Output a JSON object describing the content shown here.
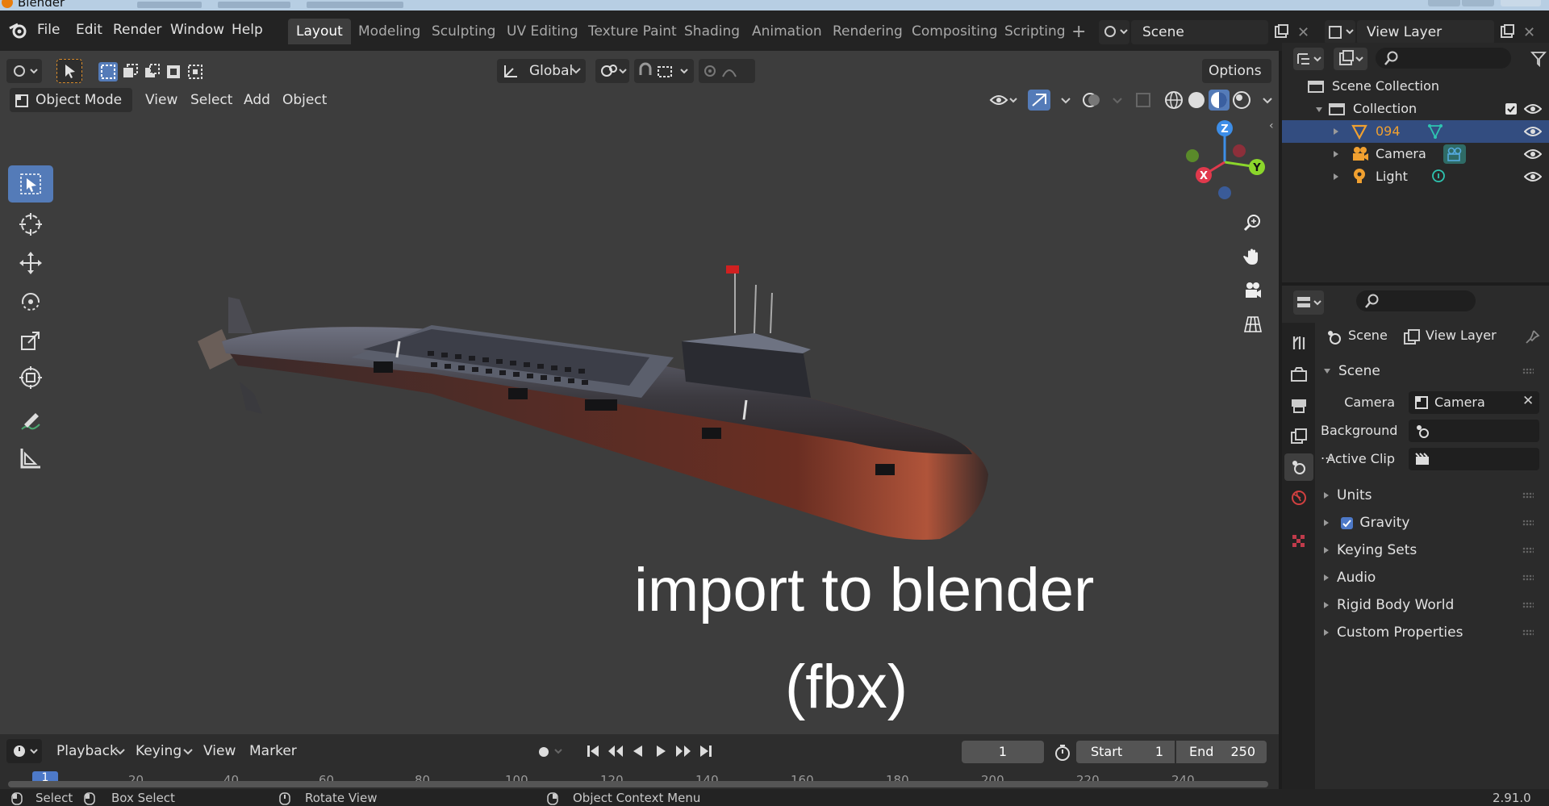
{
  "window": {
    "title": "Blender"
  },
  "menu": [
    "File",
    "Edit",
    "Render",
    "Window",
    "Help"
  ],
  "workspaces": {
    "active": "Layout",
    "tabs": [
      "Layout",
      "Modeling",
      "Sculpting",
      "UV Editing",
      "Texture Paint",
      "Shading",
      "Animation",
      "Rendering",
      "Compositing",
      "Scripting"
    ]
  },
  "scene_selector": "Scene",
  "view_layer_selector": "View Layer",
  "header_tools": {
    "transform_orientation": "Global",
    "options": "Options"
  },
  "viewport_header": {
    "mode": "Object Mode",
    "menus": [
      "View",
      "Select",
      "Add",
      "Object"
    ]
  },
  "toolbar": [
    "select-box",
    "cursor",
    "move",
    "rotate",
    "scale",
    "transform",
    "annotate",
    "measure"
  ],
  "overlay_text": {
    "line1": "import to blender",
    "line2": "(fbx)"
  },
  "gizmo": {
    "x": "X",
    "y": "Y",
    "z": "Z",
    "colors": {
      "x": "#e0394c",
      "y": "#8bd62b",
      "z": "#3d8ee8"
    }
  },
  "outliner": {
    "root": "Scene Collection",
    "collection": "Collection",
    "items": [
      {
        "name": "094",
        "type": "mesh",
        "selected": true
      },
      {
        "name": "Camera",
        "type": "camera",
        "selected": false
      },
      {
        "name": "Light",
        "type": "light",
        "selected": false
      }
    ]
  },
  "properties": {
    "breadcrumb": {
      "scene": "Scene",
      "view_layer": "View Layer"
    },
    "panel_title": "Scene",
    "fields": [
      {
        "label": "Camera",
        "value": "Camera"
      },
      {
        "label": "Background ...",
        "value": ""
      },
      {
        "label": "Active Clip",
        "value": ""
      }
    ],
    "sections": [
      "Units",
      "Gravity",
      "Keying Sets",
      "Audio",
      "Rigid Body World",
      "Custom Properties"
    ],
    "gravity_checked": true
  },
  "timeline": {
    "menus": [
      "Playback",
      "Keying",
      "View",
      "Marker"
    ],
    "current_frame": "1",
    "start_label": "Start",
    "start": "1",
    "end_label": "End",
    "end": "250",
    "ruler": [
      "1",
      "20",
      "40",
      "60",
      "80",
      "100",
      "120",
      "140",
      "160",
      "180",
      "200",
      "220",
      "240"
    ]
  },
  "statusbar": {
    "select": "Select",
    "box_select": "Box Select",
    "rotate_view": "Rotate View",
    "context_menu": "Object Context Menu",
    "version": "2.91.0"
  },
  "colors": {
    "accent": "#547bb8",
    "selected_row": "#334d80",
    "active_object": "#f0a030",
    "viewport_bg": "#3d3d3d"
  }
}
